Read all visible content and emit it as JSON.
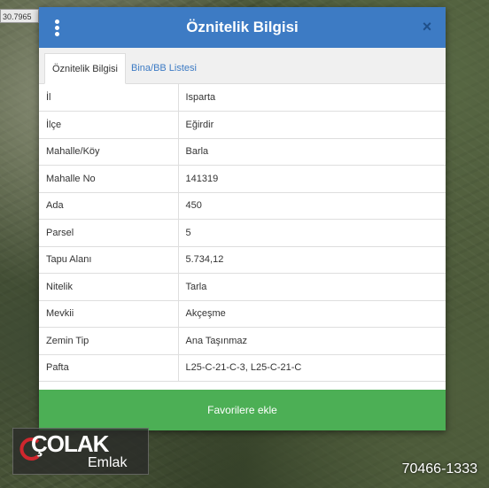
{
  "map": {
    "coordinate_label": "30.7965"
  },
  "dialog": {
    "title": "Öznitelik Bilgisi",
    "close_symbol": "×",
    "tabs": [
      {
        "label": "Öznitelik Bilgisi",
        "active": true
      },
      {
        "label": "Bina/BB Listesi",
        "active": false
      }
    ],
    "rows": [
      {
        "key": "İl",
        "value": "Isparta"
      },
      {
        "key": "İlçe",
        "value": "Eğirdir"
      },
      {
        "key": "Mahalle/Köy",
        "value": "Barla"
      },
      {
        "key": "Mahalle No",
        "value": "141319"
      },
      {
        "key": "Ada",
        "value": "450"
      },
      {
        "key": "Parsel",
        "value": "5"
      },
      {
        "key": "Tapu Alanı",
        "value": "5.734,12"
      },
      {
        "key": "Nitelik",
        "value": "Tarla"
      },
      {
        "key": "Mevkii",
        "value": "Akçeşme"
      },
      {
        "key": "Zemin Tip",
        "value": "Ana Taşınmaz"
      },
      {
        "key": "Pafta",
        "value": "L25-C-21-C-3, L25-C-21-C"
      }
    ],
    "favorite_button": "Favorilere ekle"
  },
  "watermark": {
    "brand": "ÇOLAK",
    "brand_sub": "Emlak",
    "phone": "70466-1333"
  },
  "colors": {
    "header": "#3d7bc4",
    "button": "#4caf55",
    "logo_accent": "#d0272e"
  }
}
